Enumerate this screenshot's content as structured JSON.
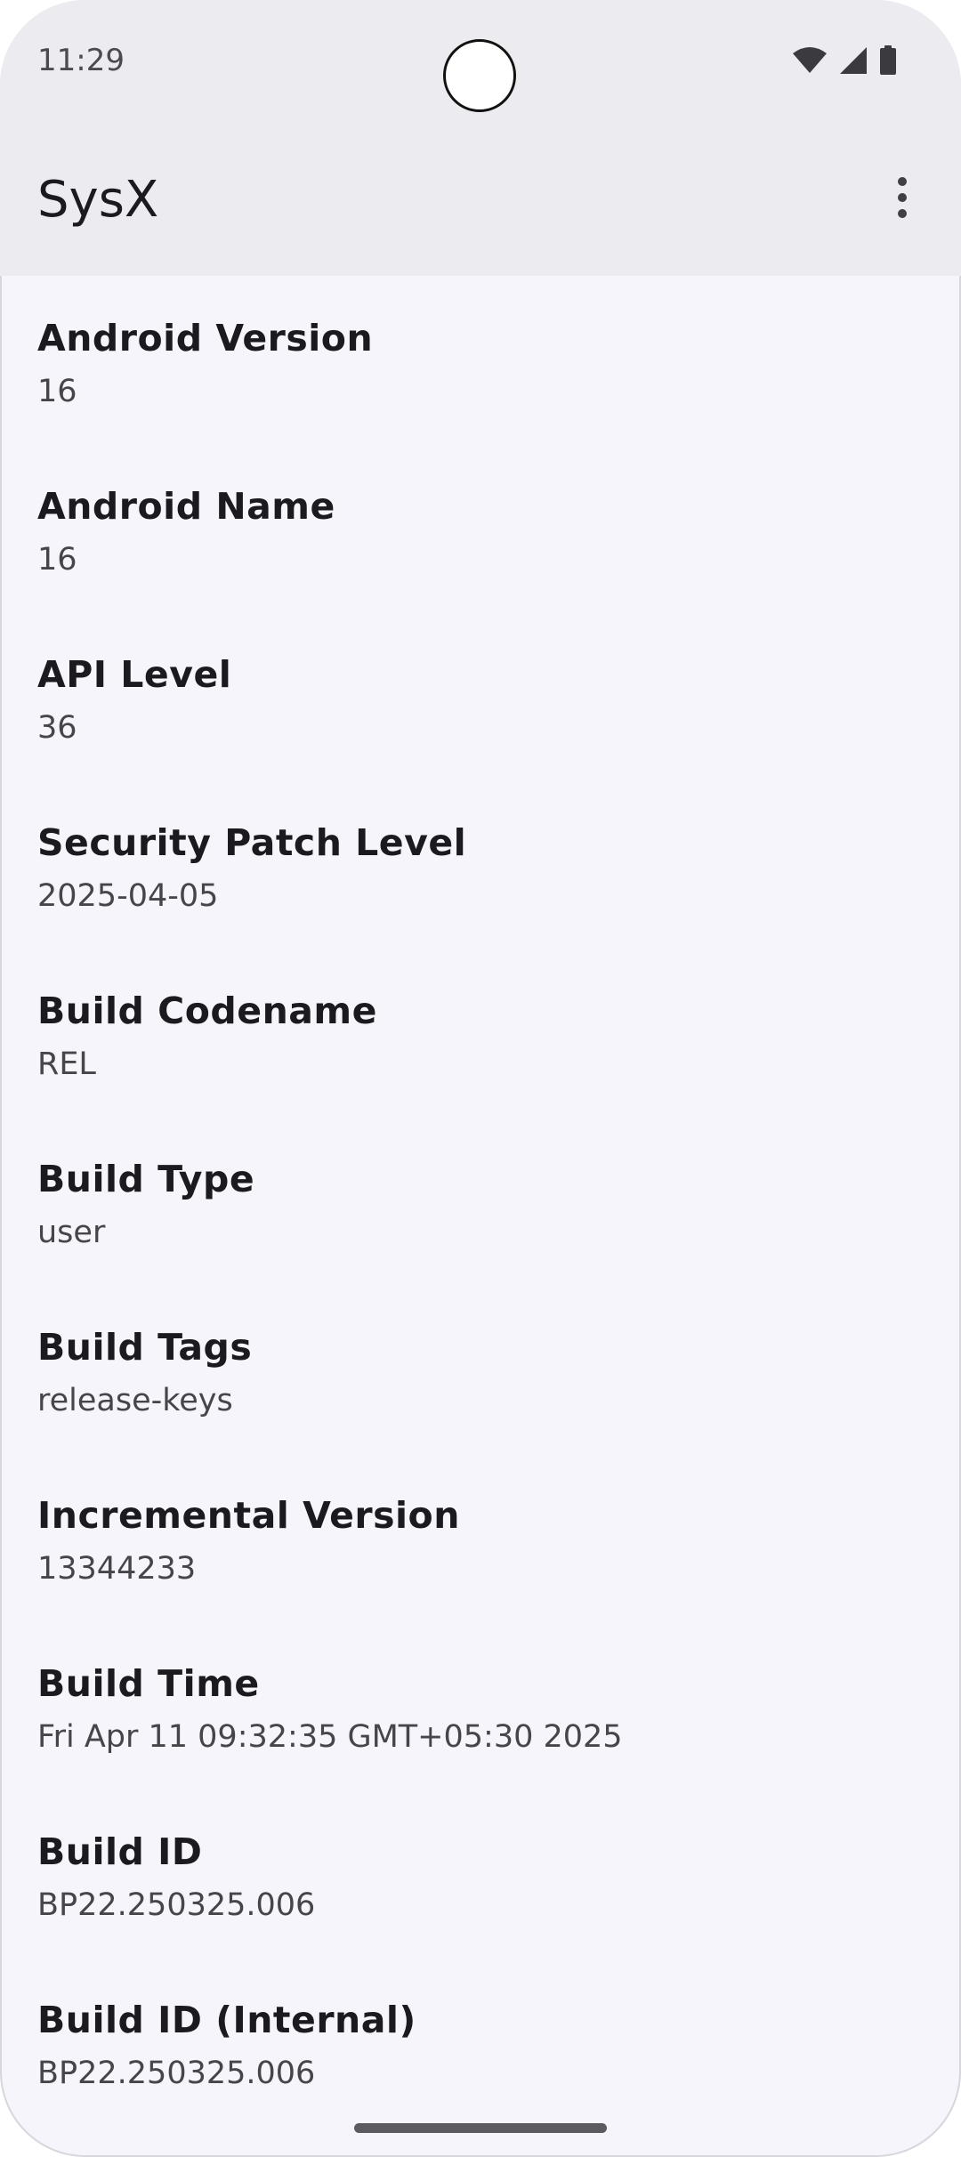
{
  "status_bar": {
    "time": "11:29",
    "icons": [
      "wifi-icon",
      "cellular-signal-icon",
      "battery-icon"
    ]
  },
  "app_bar": {
    "title": "SysX",
    "menu_icon": "more-vert-icon"
  },
  "items": [
    {
      "title": "Android Version",
      "value": "16"
    },
    {
      "title": "Android Name",
      "value": "16"
    },
    {
      "title": "API Level",
      "value": "36"
    },
    {
      "title": "Security Patch Level",
      "value": "2025-04-05"
    },
    {
      "title": "Build Codename",
      "value": "REL"
    },
    {
      "title": "Build Type",
      "value": "user"
    },
    {
      "title": "Build Tags",
      "value": "release-keys"
    },
    {
      "title": "Incremental Version",
      "value": "13344233"
    },
    {
      "title": "Build Time",
      "value": "Fri Apr 11 09:32:35 GMT+05:30 2025"
    },
    {
      "title": "Build ID",
      "value": "BP22.250325.006"
    },
    {
      "title": "Build ID (Internal)",
      "value": "BP22.250325.006"
    }
  ],
  "colors": {
    "app_bar_background": "#ecebf0",
    "content_background": "#f6f5fb",
    "title_text": "#1b1b1f",
    "value_text": "#45454a"
  }
}
